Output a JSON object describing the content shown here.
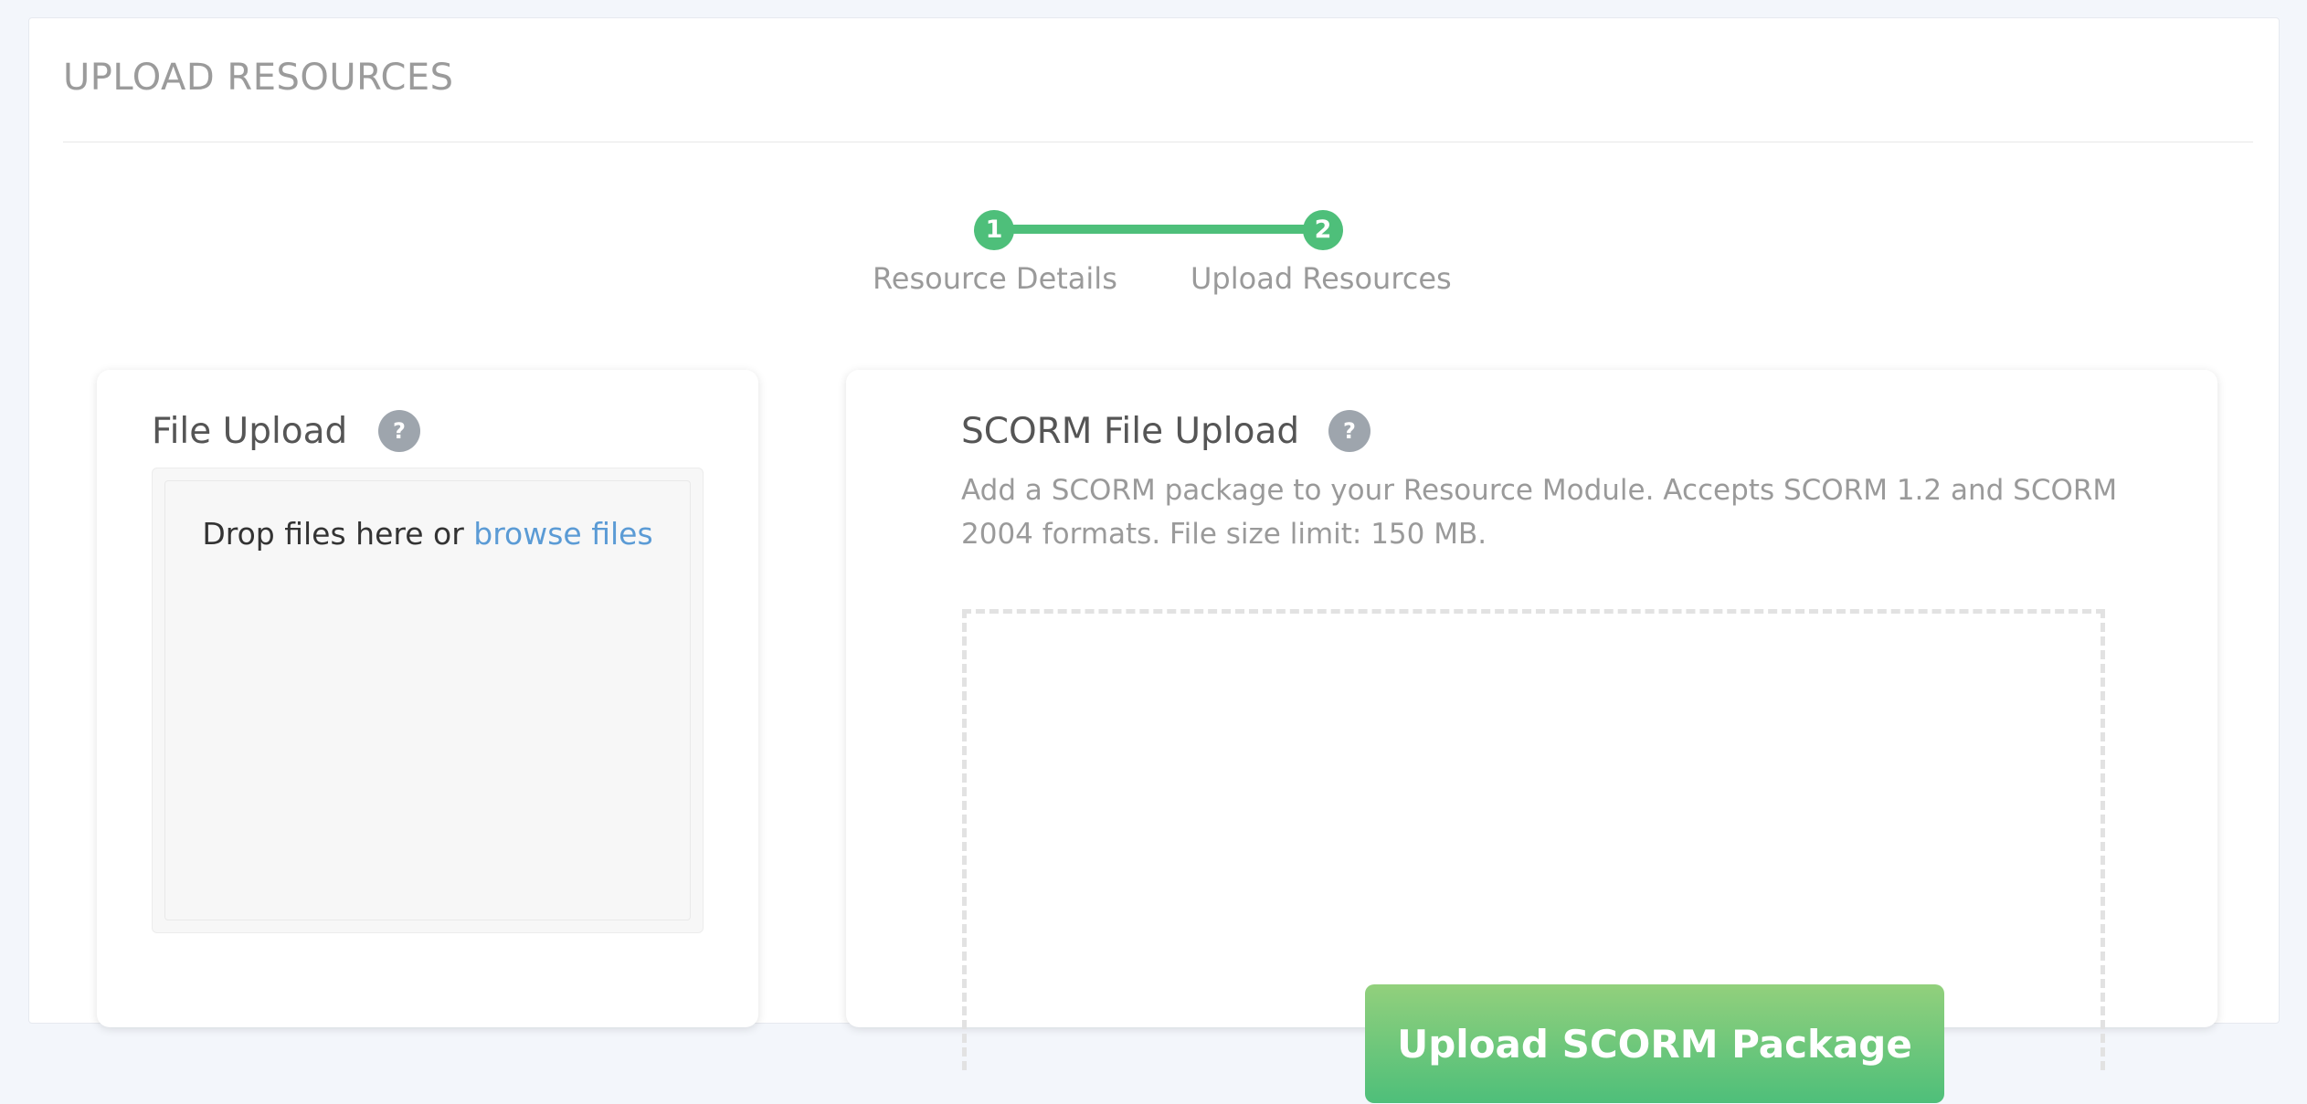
{
  "page": {
    "title": "UPLOAD RESOURCES"
  },
  "stepper": {
    "steps": [
      {
        "number": "1",
        "label": "Resource Details",
        "state": "complete"
      },
      {
        "number": "2",
        "label": "Upload Resources",
        "state": "active"
      }
    ],
    "color": "#4ebf7a"
  },
  "file_upload": {
    "title": "File Upload",
    "help_icon": "?",
    "drop_text": "Drop files here or ",
    "browse_link": "browse files"
  },
  "scorm_upload": {
    "title": "SCORM File Upload",
    "help_icon": "?",
    "description": "Add a SCORM package to your Resource Module. Accepts SCORM 1.2 and SCORM 2004 formats. File size limit: 150 MB.",
    "button_label": "Upload SCORM Package"
  },
  "colors": {
    "accent_green": "#4ebf7a",
    "link_blue": "#5b9bd5",
    "help_gray": "#9ea5ad"
  }
}
